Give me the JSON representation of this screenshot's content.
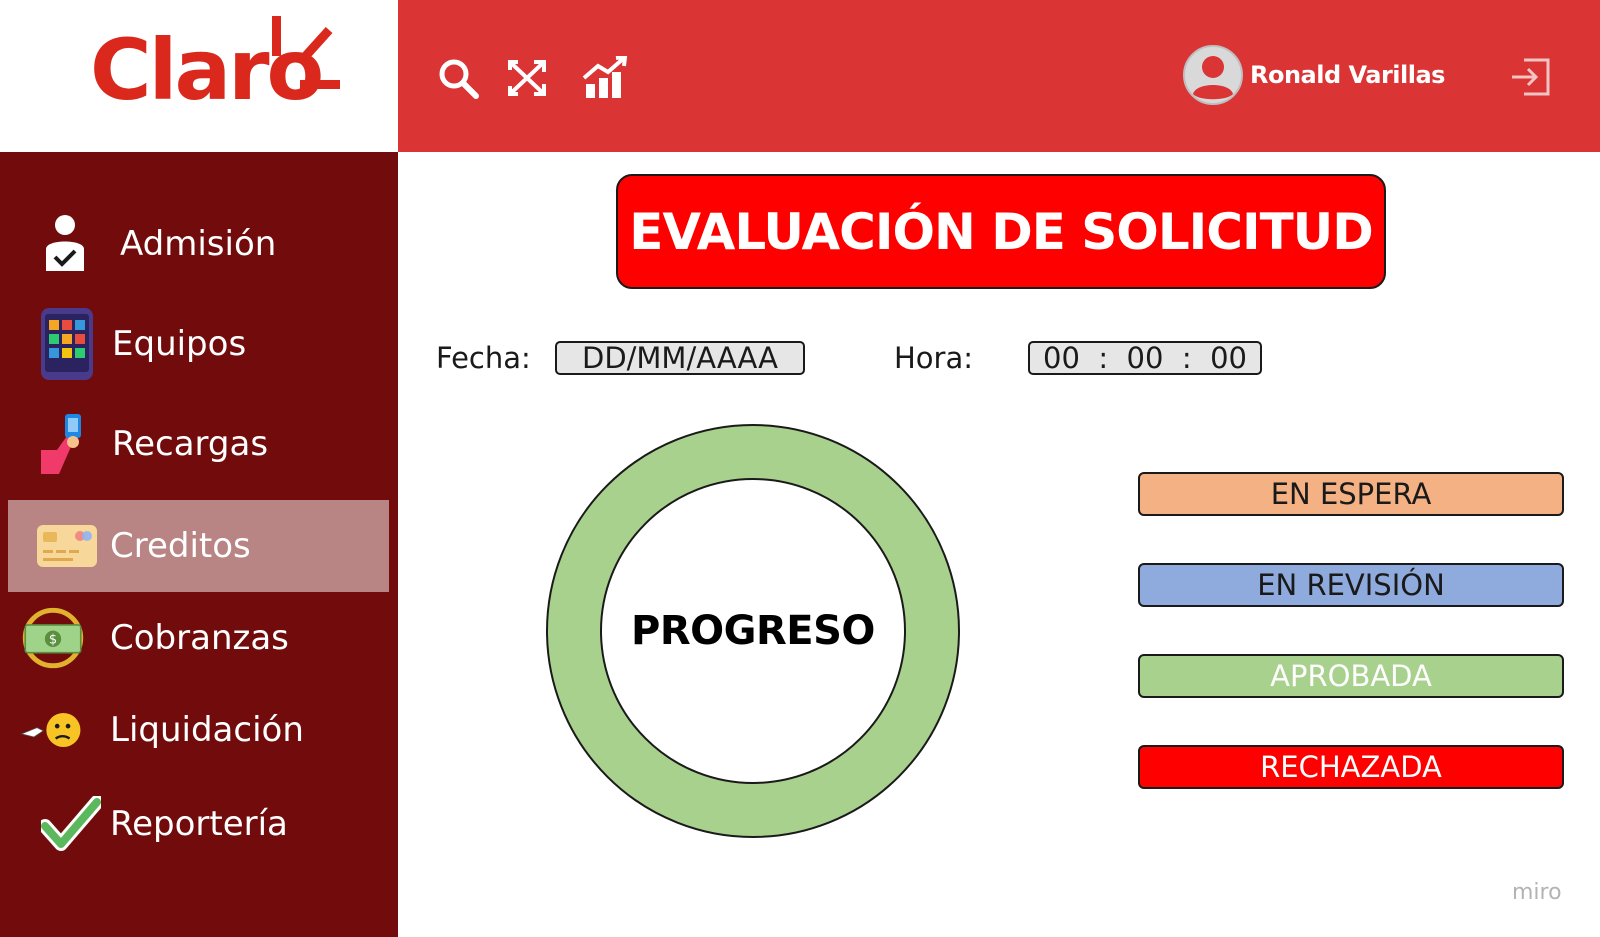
{
  "brand": {
    "logo_text": "Claro",
    "logo_color": "#da291c"
  },
  "header": {
    "icons": [
      "search-icon",
      "shuffle-icon",
      "bar-chart-icon"
    ],
    "user_name": "Ronald Varillas",
    "logout_icon": "logout-icon",
    "color": "#da3434"
  },
  "sidebar": {
    "color": "#720c0c",
    "active_color": "#b98484",
    "items": [
      {
        "label": "Admisión",
        "icon": "admission-user-check-icon",
        "active": false
      },
      {
        "label": "Equipos",
        "icon": "phone-apps-icon",
        "active": false
      },
      {
        "label": "Recargas",
        "icon": "hand-phone-icon",
        "active": false
      },
      {
        "label": "Creditos",
        "icon": "credit-card-icon",
        "active": true
      },
      {
        "label": "Cobranzas",
        "icon": "money-bill-icon",
        "active": false
      },
      {
        "label": "Liquidación",
        "icon": "emoji-face-icon",
        "active": false
      },
      {
        "label": "Reportería",
        "icon": "checkmark-icon",
        "active": false
      }
    ]
  },
  "main": {
    "title": "EVALUACIÓN DE SOLICITUD",
    "fecha_label": "Fecha:",
    "fecha_value": "DD/MM/AAAA",
    "hora_label": "Hora:",
    "hora_value": "00  :  00  :  00",
    "progress_label": "PROGRESO",
    "statuses": [
      {
        "label": "EN ESPERA",
        "color": "#f4b183",
        "text_color": "#1a1a1a"
      },
      {
        "label": "EN REVISIÓN",
        "color": "#8faadc",
        "text_color": "#1a1a1a"
      },
      {
        "label": "APROBADA",
        "color": "#a9d18e",
        "text_color": "#ffffff"
      },
      {
        "label": "RECHAZADA",
        "color": "#fe0000",
        "text_color": "#ffffff"
      }
    ]
  },
  "watermark": "miro"
}
